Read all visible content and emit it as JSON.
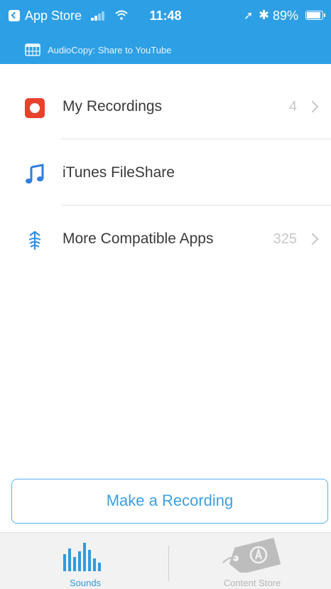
{
  "status_bar": {
    "back_app": "App Store",
    "time": "11:48",
    "battery": "89%",
    "battery_level": 0.89
  },
  "banner": {
    "text": "AudioCopy: Share to YouTube"
  },
  "list": [
    {
      "label": "My Recordings",
      "count": "4",
      "icon": "record-icon"
    },
    {
      "label": "iTunes FileShare",
      "count": "",
      "icon": "music-note-icon"
    },
    {
      "label": "More Compatible Apps",
      "count": "325",
      "icon": "compatible-apps-icon"
    }
  ],
  "record_button": {
    "label": "Make a Recording"
  },
  "tabs": [
    {
      "label": "Sounds",
      "icon": "sound-bars-icon",
      "active": true
    },
    {
      "label": "Content Store",
      "icon": "price-tag-icon",
      "active": false
    }
  ],
  "colors": {
    "header": "#2d9fe5",
    "accent": "#3d9fe0",
    "record_red": "#e8412c",
    "inactive": "#b6b6b6"
  }
}
